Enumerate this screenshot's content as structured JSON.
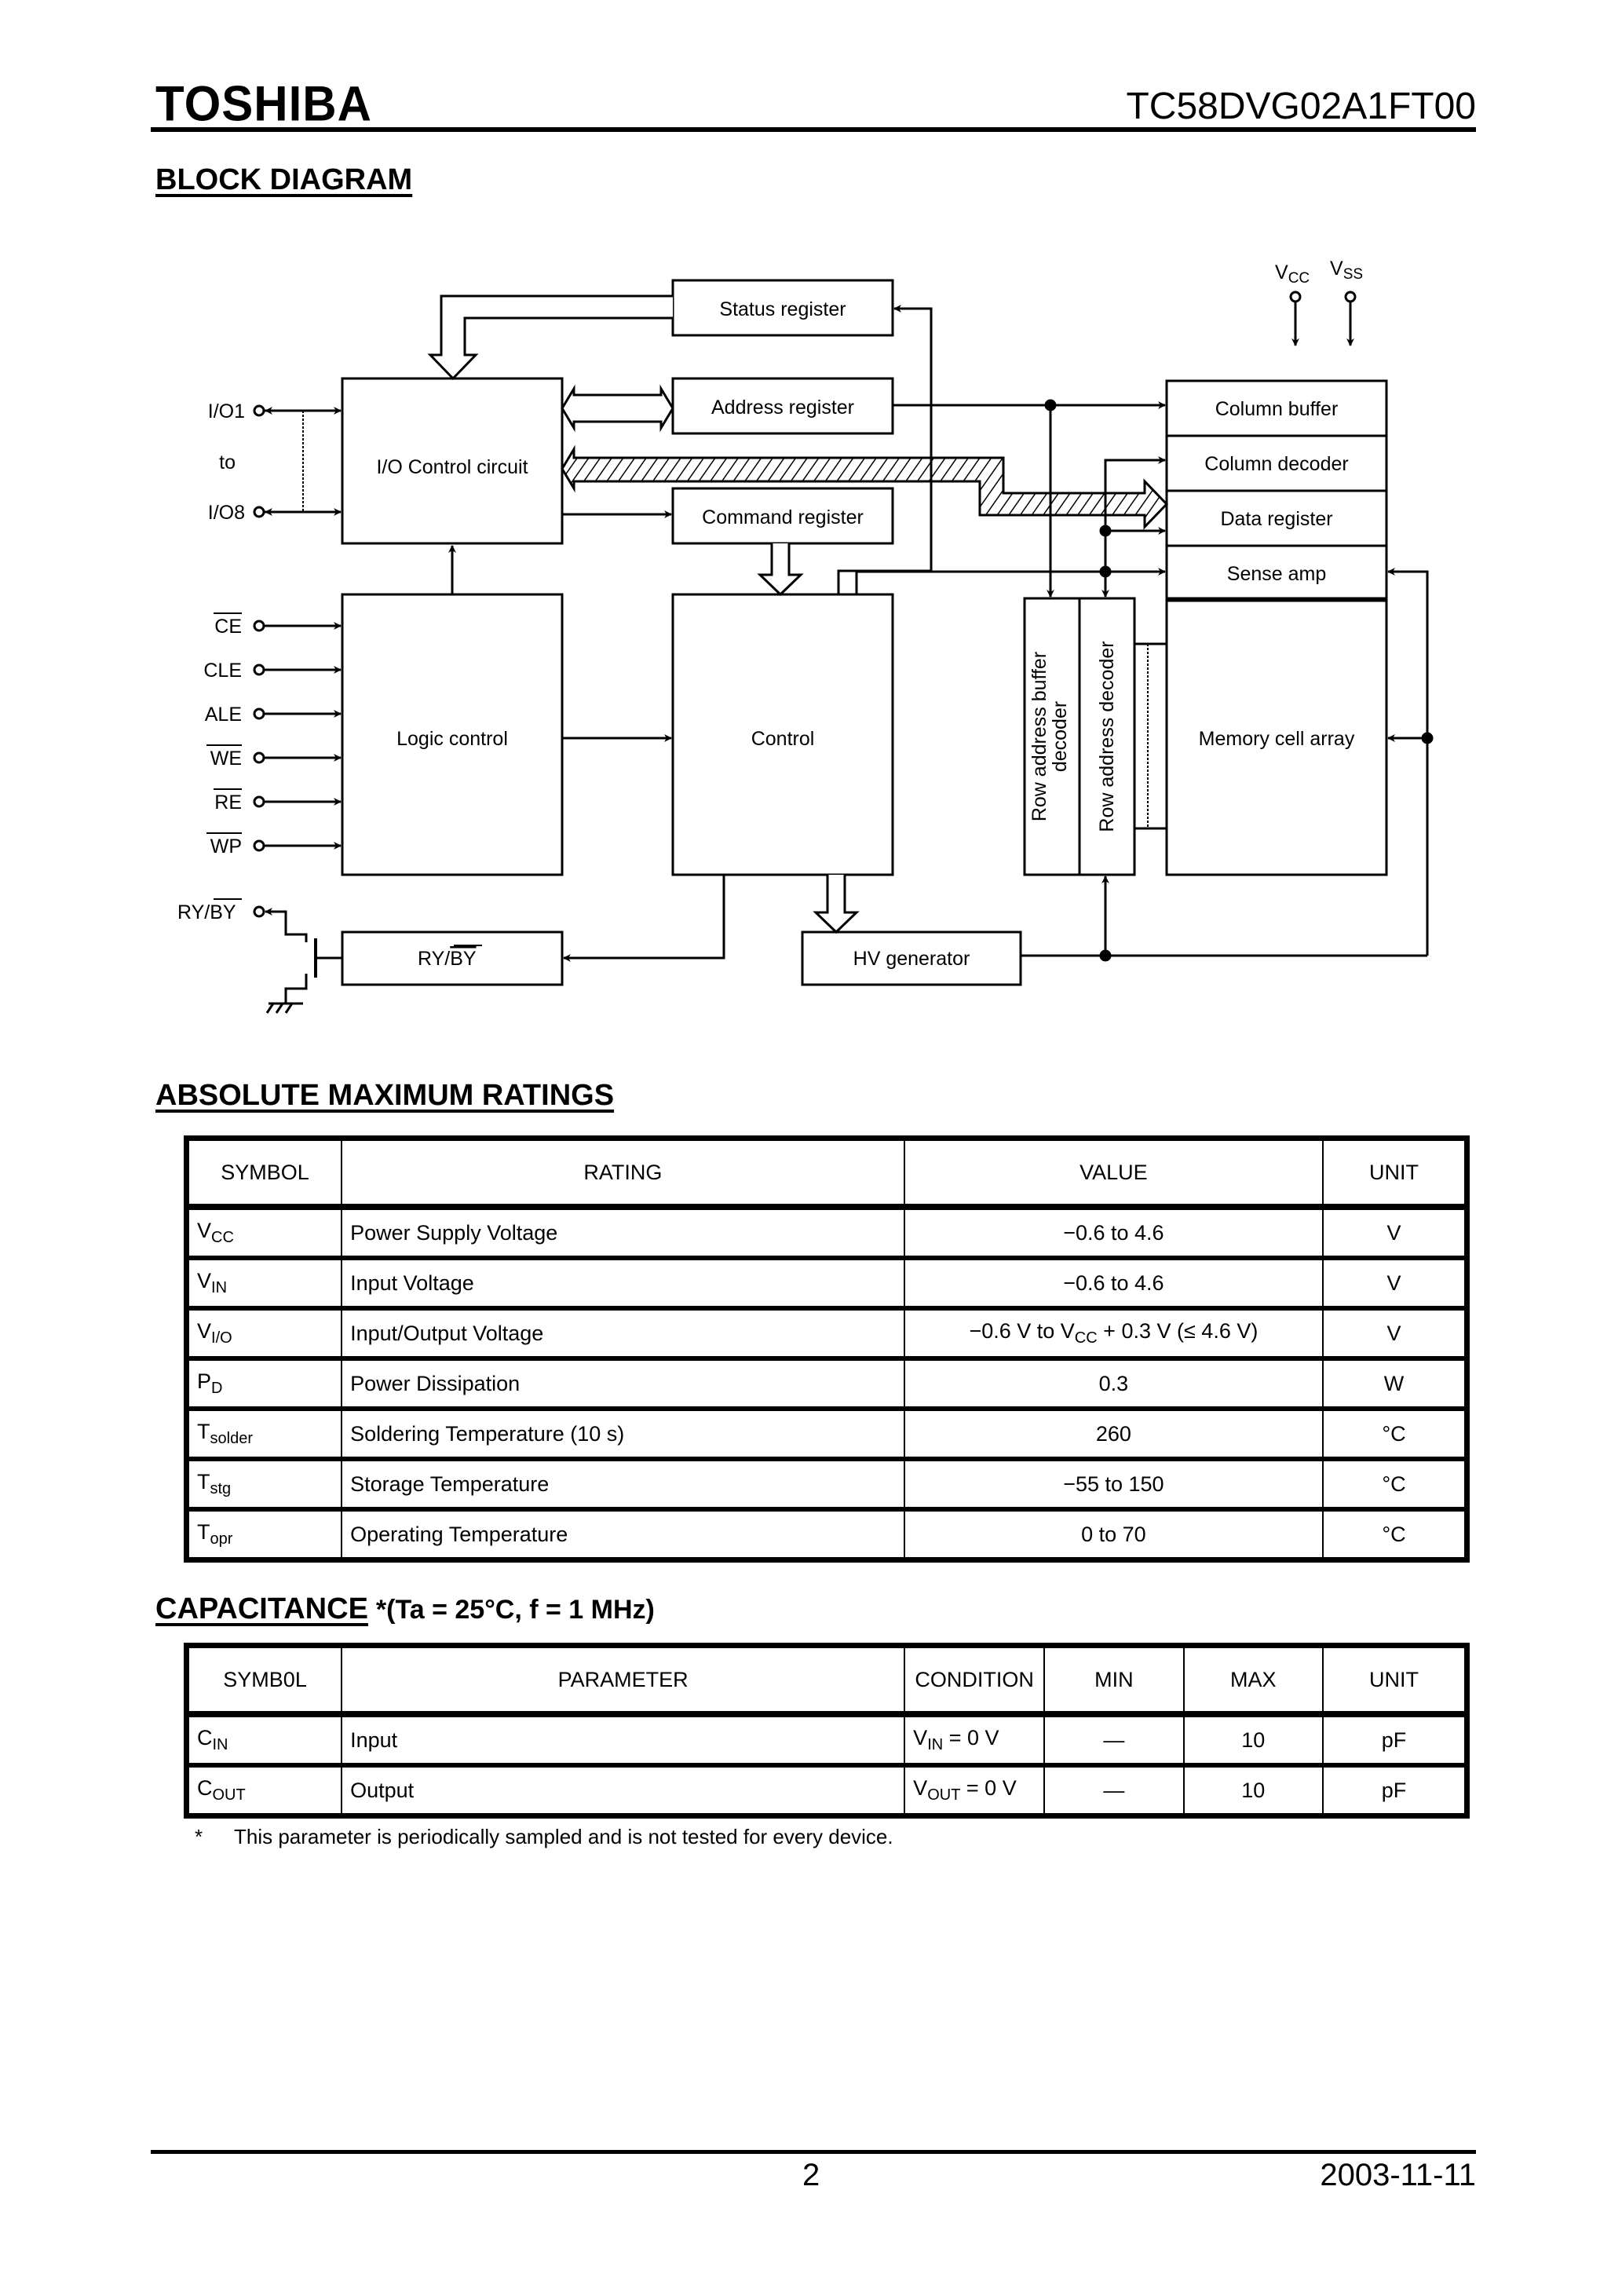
{
  "header": {
    "brand": "TOSHIBA",
    "part_number": "TC58DVG02A1FT00"
  },
  "block_diagram": {
    "title": "BLOCK DIAGRAM",
    "blocks": {
      "status_register": "Status register",
      "address_register": "Address register",
      "command_register": "Command register",
      "io_control": "I/O Control circuit",
      "logic_control": "Logic control",
      "control": "Control",
      "ry_by_block_prefix": "RY/",
      "ry_by_block_bar": "BY",
      "hv_generator": "HV generator",
      "column_buffer": "Column buffer",
      "column_decoder": "Column decoder",
      "data_register": "Data register",
      "sense_amp": "Sense amp",
      "memory_cell_array": "Memory cell array",
      "row_addr_buffer_line1": "Row address buffer",
      "row_addr_buffer_line2": "decoder",
      "row_addr_decoder": "Row address decoder"
    },
    "pins": {
      "io1": "I/O1",
      "to": "to",
      "io8": "I/O8",
      "ce": "CE",
      "cle": "CLE",
      "ale": "ALE",
      "we": "WE",
      "re": "RE",
      "wp": "WP",
      "ry_prefix": "RY/",
      "by_bar": "BY",
      "vcc_main": "V",
      "vcc_sub": "CC",
      "vss_main": "V",
      "vss_sub": "SS"
    }
  },
  "absolute_maximum_ratings": {
    "title": "ABSOLUTE MAXIMUM RATINGS",
    "headers": [
      "SYMBOL",
      "RATING",
      "VALUE",
      "UNIT"
    ],
    "rows": [
      {
        "sym": "V",
        "sub": "CC",
        "rating": "Power Supply Voltage",
        "value": "−0.6 to 4.6",
        "unit": "V"
      },
      {
        "sym": "V",
        "sub": "IN",
        "rating": "Input Voltage",
        "value": "−0.6 to 4.6",
        "unit": "V"
      },
      {
        "sym": "V",
        "sub": "I/O",
        "rating": "Input/Output Voltage",
        "value_pre": "−0.6 V to V",
        "value_sub": "CC",
        "value_post": " + 0.3 V (≤ 4.6 V)",
        "unit": "V"
      },
      {
        "sym": "P",
        "sub": "D",
        "rating": "Power Dissipation",
        "value": "0.3",
        "unit": "W"
      },
      {
        "sym": "T",
        "sub": "solder",
        "rating": "Soldering Temperature (10 s)",
        "value": "260",
        "unit": "°C"
      },
      {
        "sym": "T",
        "sub": "stg",
        "rating": "Storage Temperature",
        "value": "−55 to 150",
        "unit": "°C"
      },
      {
        "sym": "T",
        "sub": "opr",
        "rating": "Operating Temperature",
        "value": "0 to 70",
        "unit": "°C"
      }
    ]
  },
  "capacitance": {
    "title": "CAPACITANCE",
    "condition": "*(Ta = 25°C, f = 1 MHz)",
    "headers": [
      "SYMB0L",
      "PARAMETER",
      "CONDITION",
      "MIN",
      "MAX",
      "UNIT"
    ],
    "rows": [
      {
        "sym": "C",
        "sub": "IN",
        "parameter": "Input",
        "cond_main": "V",
        "cond_sub": "IN",
        "cond_rest": " = 0 V",
        "min": "—",
        "max": "10",
        "unit": "pF"
      },
      {
        "sym": "C",
        "sub": "OUT",
        "parameter": "Output",
        "cond_main": "V",
        "cond_sub": "OUT",
        "cond_rest": " = 0 V",
        "min": "—",
        "max": "10",
        "unit": "pF"
      }
    ],
    "footnote_mark": "*",
    "footnote": "This parameter is periodically sampled and is not tested for every device."
  },
  "footer": {
    "page_number": "2",
    "date": "2003-11-11"
  }
}
